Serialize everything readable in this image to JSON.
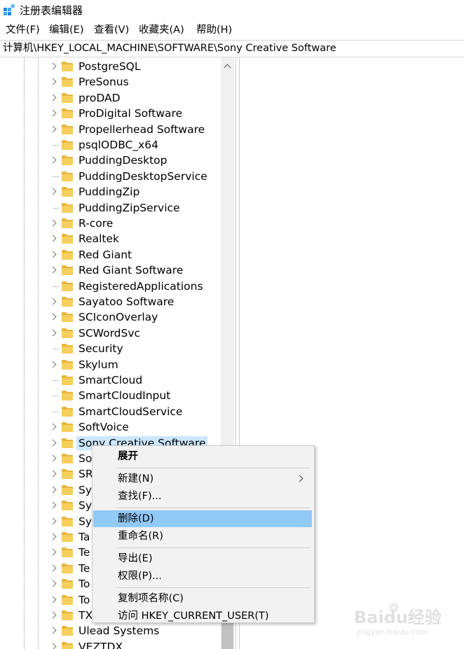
{
  "window": {
    "title": "注册表编辑器"
  },
  "menubar": {
    "items": [
      "文件(F)",
      "编辑(E)",
      "查看(V)",
      "收藏夹(A)",
      "帮助(H)"
    ]
  },
  "address": {
    "path": "计算机\\HKEY_LOCAL_MACHINE\\SOFTWARE\\Sony Creative Software"
  },
  "tree": {
    "nodes": [
      {
        "label": "PostgreSQL",
        "expandable": true
      },
      {
        "label": "PreSonus",
        "expandable": true
      },
      {
        "label": "proDAD",
        "expandable": true
      },
      {
        "label": "ProDigital Software",
        "expandable": true
      },
      {
        "label": "Propellerhead Software",
        "expandable": true
      },
      {
        "label": "psqlODBC_x64",
        "expandable": false
      },
      {
        "label": "PuddingDesktop",
        "expandable": true
      },
      {
        "label": "PuddingDesktopService",
        "expandable": false
      },
      {
        "label": "PuddingZip",
        "expandable": true
      },
      {
        "label": "PuddingZipService",
        "expandable": false
      },
      {
        "label": "R-core",
        "expandable": true
      },
      {
        "label": "Realtek",
        "expandable": true
      },
      {
        "label": "Red Giant",
        "expandable": true
      },
      {
        "label": "Red Giant Software",
        "expandable": true
      },
      {
        "label": "RegisteredApplications",
        "expandable": false
      },
      {
        "label": "Sayatoo Software",
        "expandable": true
      },
      {
        "label": "SCIconOverlay",
        "expandable": true
      },
      {
        "label": "SCWordSvc",
        "expandable": true
      },
      {
        "label": "Security",
        "expandable": false
      },
      {
        "label": "Skylum",
        "expandable": true
      },
      {
        "label": "SmartCloud",
        "expandable": false
      },
      {
        "label": "SmartCloudInput",
        "expandable": false
      },
      {
        "label": "SmartCloudService",
        "expandable": false
      },
      {
        "label": "SoftVoice",
        "expandable": true
      },
      {
        "label": "Sony Creative Software",
        "expandable": true,
        "selected": true
      },
      {
        "label": "So",
        "expandable": true
      },
      {
        "label": "SR",
        "expandable": true
      },
      {
        "label": "Sy",
        "expandable": true
      },
      {
        "label": "Sy",
        "expandable": true
      },
      {
        "label": "Sy",
        "expandable": true
      },
      {
        "label": "Ta",
        "expandable": true
      },
      {
        "label": "Te",
        "expandable": true
      },
      {
        "label": "Te",
        "expandable": true
      },
      {
        "label": "To",
        "expandable": true
      },
      {
        "label": "To",
        "expandable": true
      },
      {
        "label": "TX",
        "expandable": true
      },
      {
        "label": "Ulead Systems",
        "expandable": true
      },
      {
        "label": "VEZTDX",
        "expandable": true
      }
    ]
  },
  "context_menu": {
    "groups": [
      [
        {
          "label": "展开",
          "bold": true
        }
      ],
      [
        {
          "label": "新建(N)",
          "submenu": true
        },
        {
          "label": "查找(F)..."
        }
      ],
      [
        {
          "label": "删除(D)",
          "hover": true
        },
        {
          "label": "重命名(R)"
        }
      ],
      [
        {
          "label": "导出(E)"
        },
        {
          "label": "权限(P)..."
        }
      ],
      [
        {
          "label": "复制项名称(C)"
        },
        {
          "label": "访问 HKEY_CURRENT_USER(T)"
        }
      ]
    ]
  },
  "watermark": {
    "logo": "Baidu经验",
    "sub": "jingyan.baidu.com"
  },
  "colors": {
    "selection": "#cce8ff",
    "menu_hover": "#91c9f7",
    "folder": "#f6cf5c"
  }
}
